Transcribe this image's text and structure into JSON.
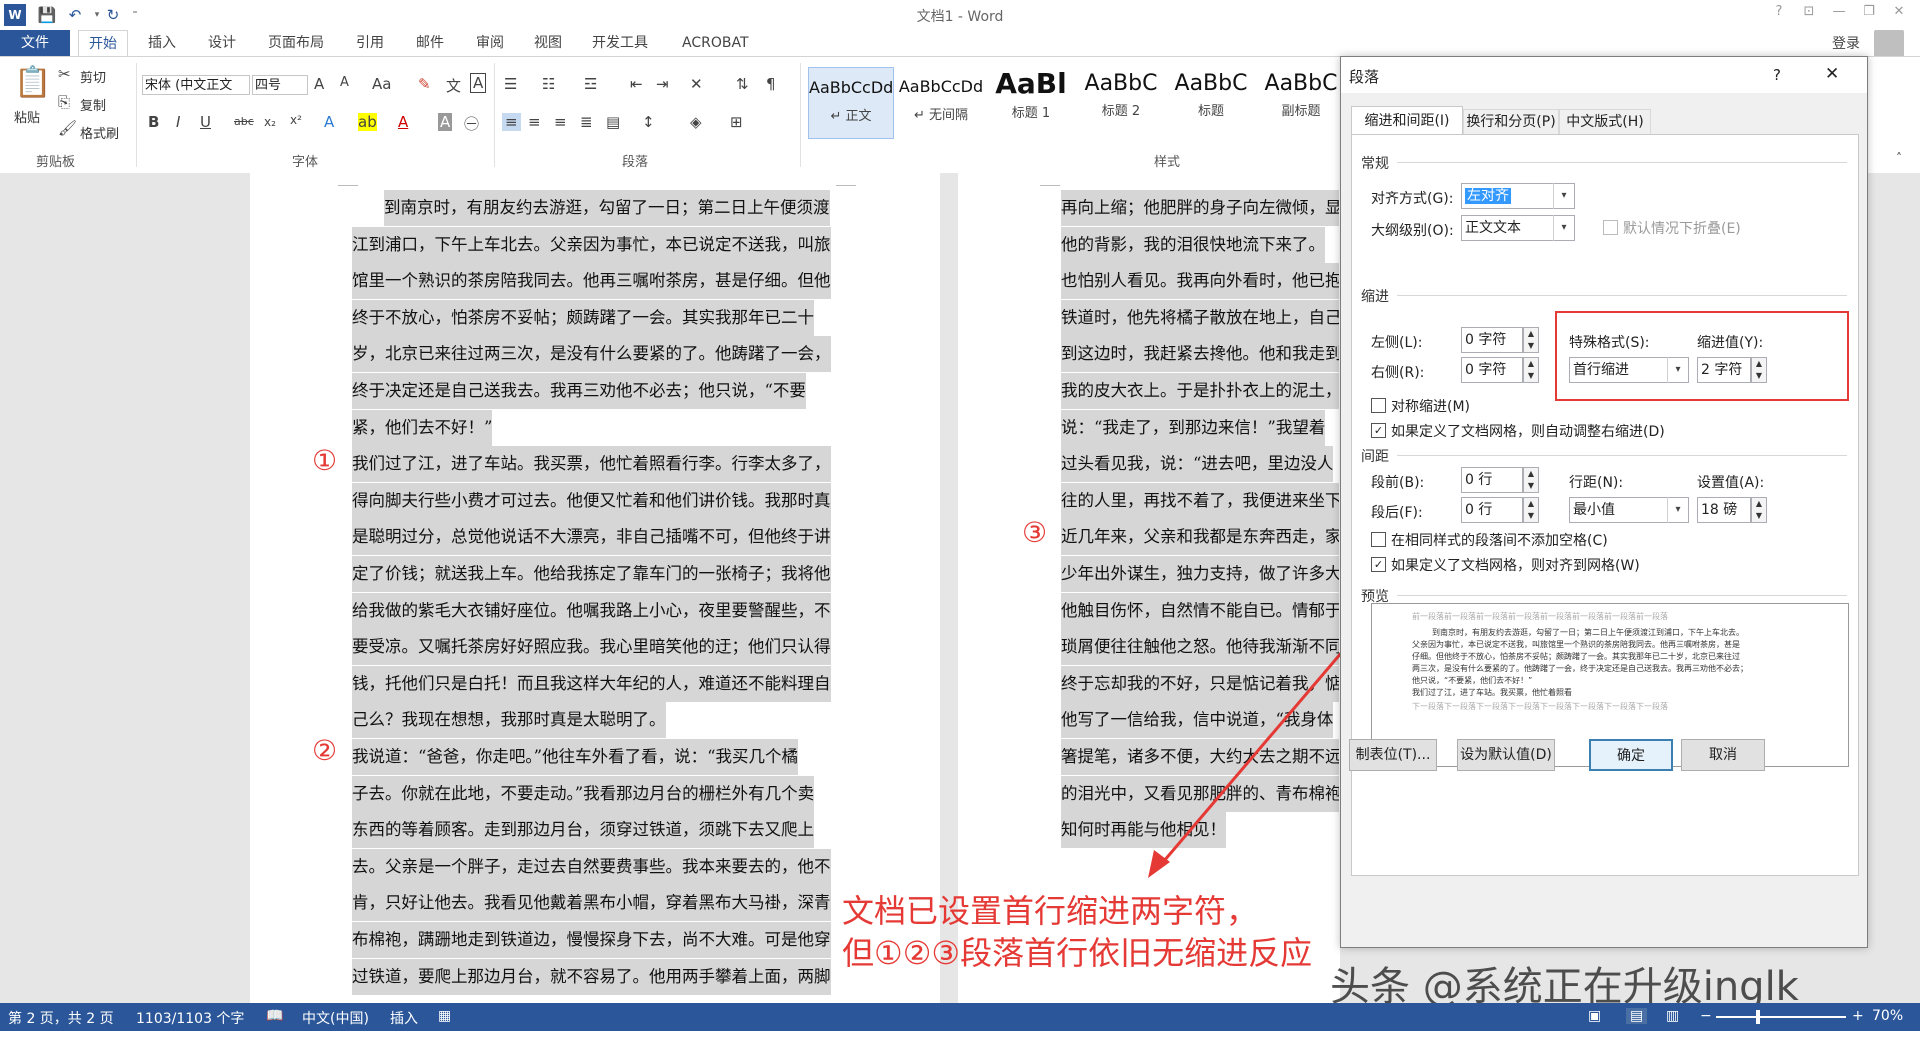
{
  "title_bar": {
    "title": "文档1 - Word",
    "help": "?",
    "minimize": "—",
    "restore": "❐",
    "close": "✕"
  },
  "tabs": {
    "file": "文件",
    "items": [
      "开始",
      "插入",
      "设计",
      "页面布局",
      "引用",
      "邮件",
      "审阅",
      "视图",
      "开发工具",
      "ACROBAT"
    ]
  },
  "account": {
    "login": "登录"
  },
  "ribbon": {
    "clipboard": {
      "paste": "粘贴",
      "cut": "剪切",
      "copy": "复制",
      "format_painter": "格式刷",
      "label": "剪贴板"
    },
    "font": {
      "font_name": "宋体 (中文正文",
      "font_size": "四号",
      "label": "字体"
    },
    "paragraph": {
      "label": "段落"
    },
    "styles": {
      "label": "样式",
      "items": [
        {
          "preview": "AaBbCcDd",
          "name": "↵ 正文"
        },
        {
          "preview": "AaBbCcDd",
          "name": "↵ 无间隔"
        },
        {
          "preview": "AaBl",
          "name": "标题 1"
        },
        {
          "preview": "AaBbC",
          "name": "标题 2"
        },
        {
          "preview": "AaBbC",
          "name": "标题"
        },
        {
          "preview": "AaBbC",
          "name": "副标题"
        }
      ]
    }
  },
  "page1_lines": [
    "到南京时，有朋友约去游逛，勾留了一日；第二日上午便须渡",
    "江到浦口，下午上车北去。父亲因为事忙，本已说定不送我，叫旅",
    "馆里一个熟识的茶房陪我同去。他再三嘱咐茶房，甚是仔细。但他",
    "终于不放心，怕茶房不妥帖；颇踌躇了一会。其实我那年已二十",
    "岁，北京已来往过两三次，是没有什么要紧的了。他踌躇了一会，",
    "终于决定还是自己送我去。我再三劝他不必去；他只说，“不要",
    "紧，他们去不好！”",
    "我们过了江，进了车站。我买票，他忙着照看行李。行李太多了，",
    "得向脚夫行些小费才可过去。他便又忙着和他们讲价钱。我那时真",
    "是聪明过分，总觉他说话不大漂亮，非自己插嘴不可，但他终于讲",
    "定了价钱；就送我上车。他给我拣定了靠车门的一张椅子；我将他",
    "给我做的紫毛大衣铺好座位。他嘱我路上小心，夜里要警醒些，不",
    "要受凉。又嘱托茶房好好照应我。我心里暗笑他的迂；他们只认得",
    "钱，托他们只是白托！而且我这样大年纪的人，难道还不能料理自",
    "己么？我现在想想，我那时真是太聪明了。",
    "我说道：“爸爸，你走吧。”他往车外看了看，说：“我买几个橘",
    "子去。你就在此地，不要走动。”我看那边月台的栅栏外有几个卖",
    "东西的等着顾客。走到那边月台，须穿过铁道，须跳下去又爬上",
    "去。父亲是一个胖子，走过去自然要费事些。我本来要去的，他不",
    "肯，只好让他去。我看见他戴着黑布小帽，穿着黑布大马褂，深青",
    "布棉袍，蹒跚地走到铁道边，慢慢探身下去，尚不大难。可是他穿",
    "过铁道，要爬上那边月台，就不容易了。他用两手攀着上面，两脚"
  ],
  "page2_lines": [
    "再向上缩；他肥胖的身子向左微倾，显",
    "他的背影，我的泪很快地流下来了。",
    "也怕别人看见。我再向外看时，他已抱",
    "铁道时，他先将橘子散放在地上，自己",
    "到这边时，我赶紧去搀他。他和我走到",
    "我的皮大衣上。于是扑扑衣上的泥土，",
    "说：“我走了，到那边来信！”我望着",
    "过头看见我，说：“进去吧，里边没人",
    "往的人里，再找不着了，我便进来坐下",
    "近几年来，父亲和我都是东奔西走，家",
    "少年出外谋生，独力支持，做了许多大",
    "他触目伤怀，自然情不能自已。情郁于",
    "琐屑便往往触他之怒。他待我渐渐不同",
    "终于忘却我的不好，只是惦记着我，惦",
    "他写了一信给我，信中说道，“我身体",
    "箸提笔，诸多不便，大约大去之期不远",
    "的泪光中，又看见那肥胖的、青布棉袍",
    "知何时再能与他相见！"
  ],
  "markers": [
    "①",
    "②",
    "③"
  ],
  "annotation": {
    "line1": "文档已设置首行缩进两字符，",
    "line2": "但①②③段落首行依旧无缩进反应"
  },
  "watermark": "头条 @系统正在升级inglk",
  "dialog": {
    "title": "段落",
    "help": "?",
    "close": "✕",
    "tabs": [
      "缩进和间距(I)",
      "换行和分页(P)",
      "中文版式(H)"
    ],
    "general": {
      "section": "常规",
      "alignment_label": "对齐方式(G):",
      "alignment_value": "左对齐",
      "outline_label": "大纲级别(O):",
      "outline_value": "正文文本",
      "collapse_label": "默认情况下折叠(E)"
    },
    "indent": {
      "section": "缩进",
      "left_label": "左侧(L):",
      "left_value": "0 字符",
      "right_label": "右侧(R):",
      "right_value": "0 字符",
      "special_label": "特殊格式(S):",
      "special_value": "首行缩进",
      "by_label": "缩进值(Y):",
      "by_value": "2 字符",
      "mirror_label": "对称缩进(M)",
      "auto_adjust_label": "如果定义了文档网格，则自动调整右缩进(D)"
    },
    "spacing": {
      "section": "间距",
      "before_label": "段前(B):",
      "before_value": "0 行",
      "after_label": "段后(F):",
      "after_value": "0 行",
      "line_label": "行距(N):",
      "line_value": "最小值",
      "at_label": "设置值(A):",
      "at_value": "18 磅",
      "no_space_label": "在相同样式的段落间不添加空格(C)",
      "snap_grid_label": "如果定义了文档网格，则对齐到网格(W)"
    },
    "preview": {
      "section": "预览",
      "before": "前一段落前一段落前一段落前一段落前一段落前一段落前一段落前一段落",
      "text1": "到南京时，有朋友约去游逛，勾留了一日；第二日上午便须渡江到浦口，下午上车北去。",
      "text2": "父亲因为事忙，本已说定不送我，叫旅馆里一个熟识的茶房陪我同去。他再三嘱咐茶房，甚是",
      "text3": "仔细。但他终于不放心，怕茶房不妥帖；颇踌躇了一会。其实我那年已二十岁，北京已来往过",
      "text4": "两三次，是没有什么要紧的了。他踌躇了一会，终于决定还是自己送我去。我再三劝他不必去；",
      "text5": "他只说，“不要紧，他们去不好！”",
      "text6": "我们过了江，进了车站。我买票，他忙着照看",
      "after": "下一段落下一段落下一段落下一段落下一段落下一段落下一段落下一段落"
    },
    "buttons": {
      "tabs": "制表位(T)...",
      "default": "设为默认值(D)",
      "ok": "确定",
      "cancel": "取消"
    }
  },
  "status": {
    "page": "第 2 页，共 2 页",
    "words": "1103/1103 个字",
    "lang": "中文(中国)",
    "mode": "插入",
    "zoom": "70%"
  }
}
